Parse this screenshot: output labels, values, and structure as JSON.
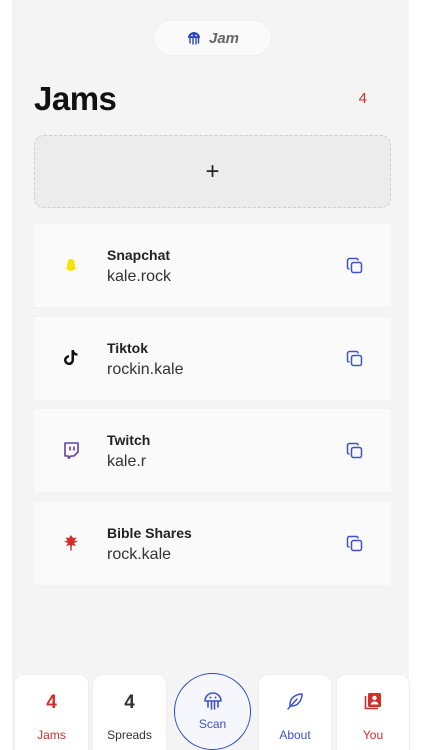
{
  "header": {
    "pill_label": "Jam",
    "title": "Jams",
    "count": "4",
    "add_symbol": "+"
  },
  "colors": {
    "accent_red": "#d0302a",
    "accent_blue": "#2b47c0",
    "snapchat": "#f5e400",
    "twitch": "#6441a5",
    "bible": "#d0302a"
  },
  "jams": [
    {
      "name": "Snapchat",
      "handle": "kale.rock",
      "icon": "snapchat-icon"
    },
    {
      "name": "Tiktok",
      "handle": "rockin.kale",
      "icon": "tiktok-icon"
    },
    {
      "name": "Twitch",
      "handle": "kale.r",
      "icon": "twitch-icon"
    },
    {
      "name": "Bible Shares",
      "handle": "rock.kale",
      "icon": "bible-shares-icon"
    }
  ],
  "nav": {
    "jams": {
      "count": "4",
      "label": "Jams"
    },
    "spreads": {
      "count": "4",
      "label": "Spreads"
    },
    "scan": {
      "label": "Scan",
      "icon": "jellyfish-icon"
    },
    "about": {
      "label": "About",
      "icon": "feather-icon"
    },
    "you": {
      "label": "You",
      "icon": "contact-book-icon"
    }
  }
}
